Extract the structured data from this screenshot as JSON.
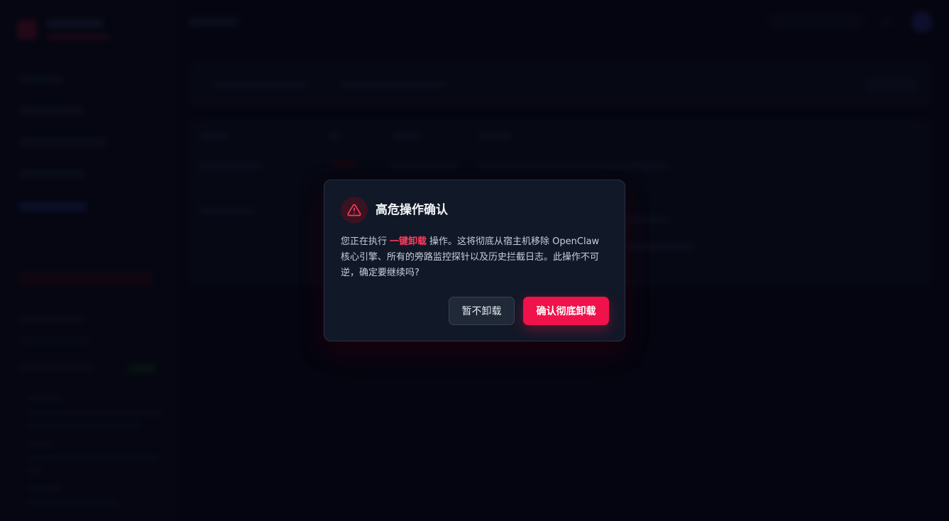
{
  "modal": {
    "title": "高危操作确认",
    "icon": "warning-triangle-icon",
    "body_prefix": "您正在执行",
    "body_highlight": "一键卸载",
    "body_suffix": "操作。这将彻底从宿主机移除 OpenClaw 核心引擎、所有的旁路监控探针以及历史拦截日志。此操作不可逆，确定要继续吗?",
    "cancel_label": "暂不卸载",
    "confirm_label": "确认彻底卸载"
  },
  "colors": {
    "accent_danger": "#f0124a",
    "highlight_text": "#ff3b61",
    "modal_bg": "#111827",
    "page_bg": "#060816"
  }
}
